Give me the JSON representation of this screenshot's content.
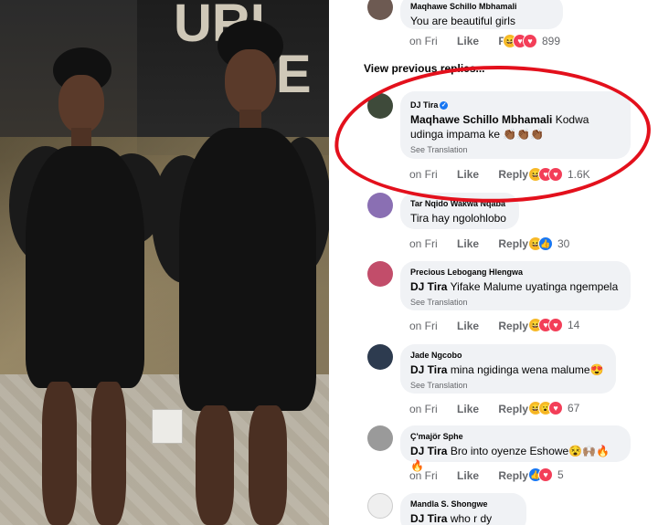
{
  "view_previous": "View previous replies...",
  "actions": {
    "like": "Like",
    "reply": "Reply"
  },
  "wall_sign": [
    "URI",
    "RE"
  ],
  "comments": [
    {
      "author": "Maqhawe Schillo Mbhamali",
      "mention": "",
      "text": "You are beautiful girls",
      "translation": "",
      "time": "on Fri",
      "reactions": [
        "haha",
        "love",
        "love"
      ],
      "count": "899"
    },
    {
      "author": "DJ Tira",
      "verified": true,
      "mention": "Maqhawe Schillo Mbhamali",
      "text": "Kodwa udinga impama ke 👏🏾👏🏾👏🏾",
      "translation": "See Translation",
      "time": "on Fri",
      "reactions": [
        "haha",
        "love",
        "love"
      ],
      "count": "1.6K"
    },
    {
      "author": "Tar Nqido Wakwa Nqaba",
      "mention": "",
      "text": "Tira hay ngolohlobo",
      "translation": "",
      "time": "on Fri",
      "reactions": [
        "haha",
        "like"
      ],
      "count": "30"
    },
    {
      "author": "Precious Lebogang Hlengwa",
      "mention": "DJ Tira",
      "text": "Yifake Malume uyatinga ngempela",
      "translation": "See Translation",
      "time": "on Fri",
      "reactions": [
        "haha",
        "love",
        "love"
      ],
      "count": "14"
    },
    {
      "author": "Jade Ngcobo",
      "mention": "DJ Tira",
      "text": "mina ngidinga wena malume😍",
      "translation": "See Translation",
      "time": "on Fri",
      "reactions": [
        "haha",
        "wow",
        "love"
      ],
      "count": "67"
    },
    {
      "author": "Ç'majör Sphe",
      "mention": "DJ Tira",
      "text": "Bro into oyenze Eshowe😵🙌🏽🔥🔥",
      "translation": "",
      "time": "on Fri",
      "reactions": [
        "like",
        "love"
      ],
      "count": "5"
    },
    {
      "author": "Mandla S. Shongwe",
      "mention": "DJ Tira",
      "text": "who r dy datin?",
      "translation": "",
      "time": "",
      "reactions": [],
      "count": ""
    }
  ],
  "colors": {
    "highlight": "#e3101c",
    "bubble": "#f0f2f5",
    "meta_text": "#65676b",
    "like_blue": "#1877f2",
    "love_red": "#f33e58",
    "haha_yellow": "#f7b928"
  }
}
